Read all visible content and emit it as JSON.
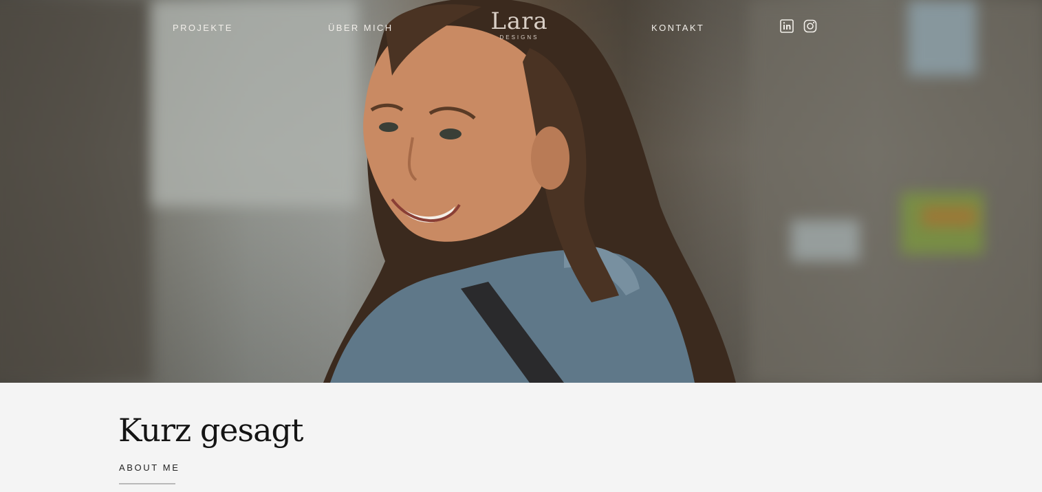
{
  "nav": {
    "links": [
      "PROJEKTE",
      "ÜBER MICH",
      "KONTAKT"
    ],
    "logo_word": "Lara",
    "logo_sub": "DESIGNS",
    "social": [
      "linkedin-icon",
      "instagram-icon"
    ]
  },
  "hero": {
    "image": "portrait of smiling woman in denim jacket looking over shoulder on street"
  },
  "section": {
    "title": "Kurz gesagt",
    "eyebrow": "ABOUT ME"
  },
  "colors": {
    "nav_text": "#f2efea",
    "logo": "#d9cfc6",
    "page_bg": "#f4f4f4",
    "title": "#141414",
    "rule": "#b9b9b9"
  }
}
